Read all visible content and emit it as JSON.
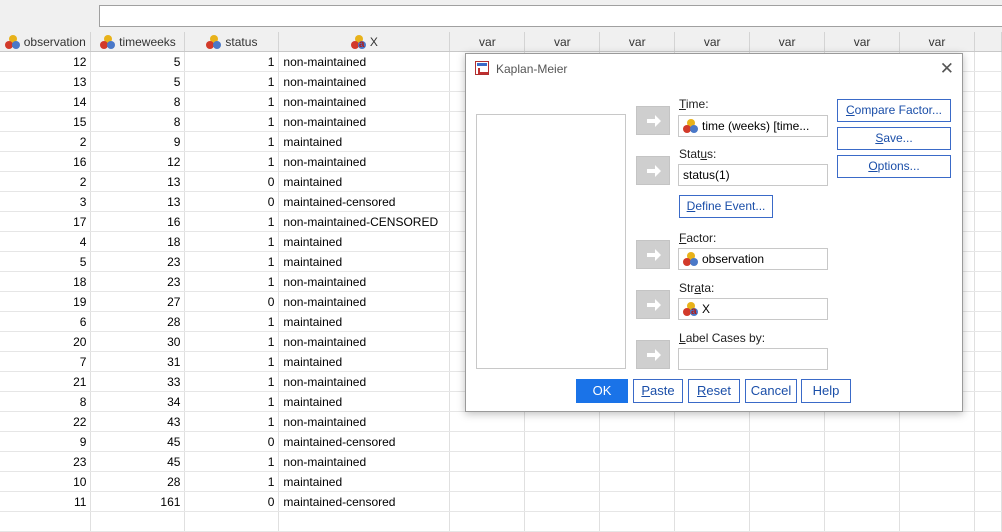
{
  "columns": [
    {
      "name": "observation",
      "icon": "nominal-variable-icon",
      "width": 91
    },
    {
      "name": "timeweeks",
      "icon": "nominal-variable-icon",
      "width": 94
    },
    {
      "name": "status",
      "icon": "nominal-variable-icon",
      "width": 94
    },
    {
      "name": "X",
      "icon": "string-nominal-variable-icon",
      "width": 171
    },
    {
      "name": "var",
      "width": 75
    },
    {
      "name": "var",
      "width": 75
    },
    {
      "name": "var",
      "width": 75
    },
    {
      "name": "var",
      "width": 75
    },
    {
      "name": "var",
      "width": 75
    },
    {
      "name": "var",
      "width": 75
    },
    {
      "name": "var",
      "width": 75
    },
    {
      "name": "",
      "width": 27
    }
  ],
  "rows": [
    [
      "12",
      "5",
      "1",
      "non-maintained"
    ],
    [
      "13",
      "5",
      "1",
      "non-maintained"
    ],
    [
      "14",
      "8",
      "1",
      "non-maintained"
    ],
    [
      "15",
      "8",
      "1",
      "non-maintained"
    ],
    [
      "2",
      "9",
      "1",
      "maintained"
    ],
    [
      "16",
      "12",
      "1",
      "non-maintained"
    ],
    [
      "2",
      "13",
      "0",
      "maintained"
    ],
    [
      "3",
      "13",
      "0",
      "maintained-censored"
    ],
    [
      "17",
      "16",
      "1",
      "non-maintained-CENSORED"
    ],
    [
      "4",
      "18",
      "1",
      "maintained"
    ],
    [
      "5",
      "23",
      "1",
      "maintained"
    ],
    [
      "18",
      "23",
      "1",
      "non-maintained"
    ],
    [
      "19",
      "27",
      "0",
      "non-maintained"
    ],
    [
      "6",
      "28",
      "1",
      "maintained"
    ],
    [
      "20",
      "30",
      "1",
      "non-maintained"
    ],
    [
      "7",
      "31",
      "1",
      "maintained"
    ],
    [
      "21",
      "33",
      "1",
      "non-maintained"
    ],
    [
      "8",
      "34",
      "1",
      "maintained"
    ],
    [
      "22",
      "43",
      "1",
      "non-maintained"
    ],
    [
      "9",
      "45",
      "0",
      "maintained-censored"
    ],
    [
      "23",
      "45",
      "1",
      "non-maintained"
    ],
    [
      "10",
      "28",
      "1",
      "maintained"
    ],
    [
      "11",
      "161",
      "0",
      "maintained-censored"
    ],
    [
      "",
      "",
      "",
      ""
    ]
  ],
  "dialog": {
    "title": "Kaplan-Meier",
    "time": {
      "label_pre": "",
      "label_u": "T",
      "label_post": "ime:",
      "value": "time (weeks) [time..."
    },
    "status": {
      "label_pre": "Stat",
      "label_u": "u",
      "label_post": "s:",
      "value": "status(1)"
    },
    "define_event": {
      "pre": "",
      "u": "D",
      "post": "efine Event..."
    },
    "factor": {
      "label_pre": "",
      "label_u": "F",
      "label_post": "actor:",
      "value": "observation"
    },
    "strata": {
      "label_pre": "Str",
      "label_u": "a",
      "label_post": "ta:",
      "value": "X"
    },
    "label_cases": {
      "label_pre": "",
      "label_u": "L",
      "label_post": "abel Cases by:",
      "value": ""
    },
    "side_buttons": {
      "compare": {
        "pre": "",
        "u": "C",
        "post": "ompare Factor..."
      },
      "save": {
        "pre": "",
        "u": "S",
        "post": "ave..."
      },
      "options": {
        "pre": "",
        "u": "O",
        "post": "ptions..."
      }
    },
    "bottom_buttons": {
      "ok": "OK",
      "paste": {
        "pre": "",
        "u": "P",
        "post": "aste"
      },
      "reset": {
        "pre": "",
        "u": "R",
        "post": "eset"
      },
      "cancel": "Cancel",
      "help": "Help"
    }
  }
}
